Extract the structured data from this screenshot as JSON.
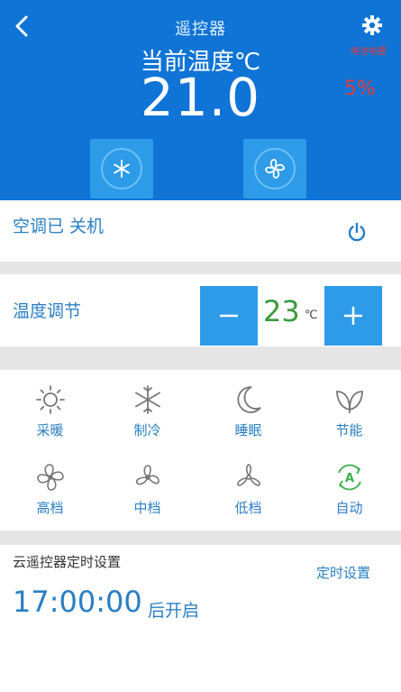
{
  "header": {
    "title": "遥控器",
    "current_temp_label": "当前温度℃",
    "current_temp_value": "21.0",
    "battery_label": "电池电量",
    "battery_percent": "5%"
  },
  "power": {
    "status_label": "空调已 关机"
  },
  "temperature": {
    "label": "温度调节",
    "minus": "−",
    "plus": "+",
    "value": "23",
    "unit": "℃"
  },
  "modes": [
    {
      "label": "采暖",
      "icon": "sun-icon"
    },
    {
      "label": "制冷",
      "icon": "snowflake-icon"
    },
    {
      "label": "睡眠",
      "icon": "moon-icon"
    },
    {
      "label": "节能",
      "icon": "leaf-icon"
    },
    {
      "label": "高档",
      "icon": "fan-high-icon"
    },
    {
      "label": "中档",
      "icon": "fan-medium-icon"
    },
    {
      "label": "低档",
      "icon": "fan-low-icon"
    },
    {
      "label": "自动",
      "icon": "auto-icon"
    }
  ],
  "timer": {
    "label": "云遥控器定时设置",
    "link": "定时设置",
    "time": "17:00:00",
    "suffix": "后开启"
  },
  "colors": {
    "header_bg": "#0f74d6",
    "accent": "#2d9be8",
    "text_blue": "#2a7fc4",
    "temp_green": "#3a9a3a",
    "battery_red": "#e53935"
  }
}
